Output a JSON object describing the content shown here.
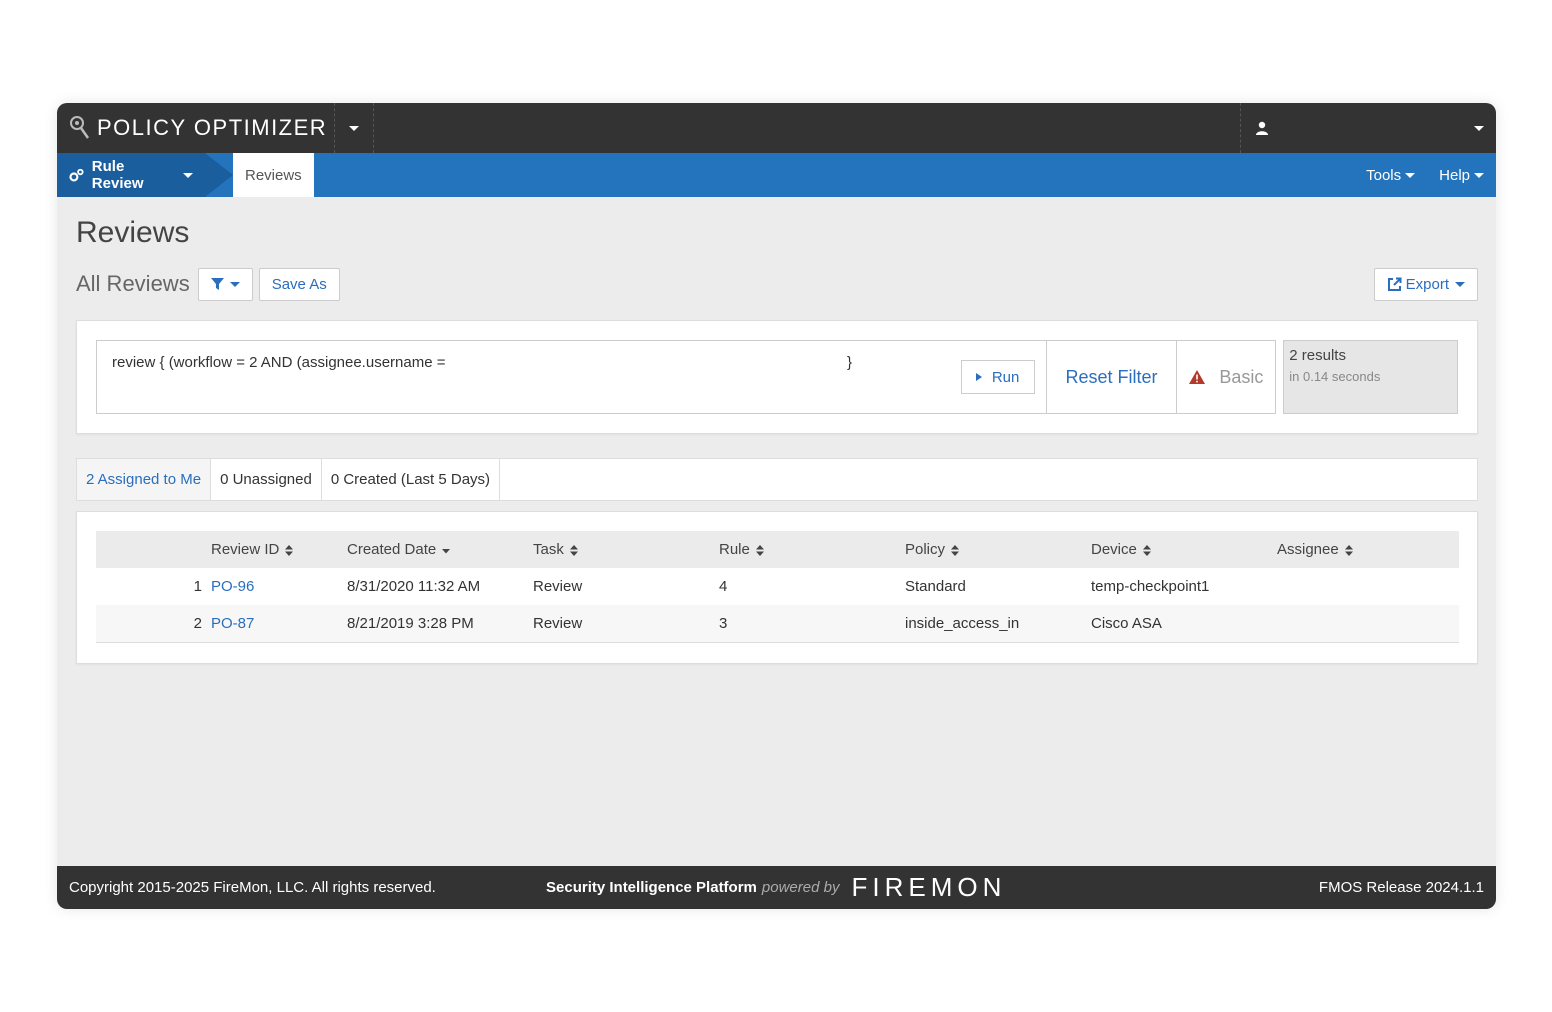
{
  "app": {
    "title": "POLICY OPTIMIZER"
  },
  "nav": {
    "module_label": "Rule Review",
    "breadcrumb": "Reviews",
    "tools_label": "Tools",
    "help_label": "Help"
  },
  "page": {
    "title": "Reviews",
    "subtitle": "All Reviews",
    "save_as_label": "Save As",
    "export_label": "Export"
  },
  "filter": {
    "query_text": "review { (workflow = 2 AND (assignee.username =",
    "query_close": "}",
    "run_label": "Run",
    "reset_label": "Reset Filter",
    "basic_label": "Basic",
    "results_count": "2 results",
    "results_time": "in 0.14 seconds"
  },
  "tabs": [
    {
      "label": "2 Assigned to Me",
      "active": true
    },
    {
      "label": "0 Unassigned",
      "active": false
    },
    {
      "label": "0 Created (Last 5 Days)",
      "active": false
    }
  ],
  "table": {
    "columns": [
      "Review ID",
      "Created Date",
      "Task",
      "Rule",
      "Policy",
      "Device",
      "Assignee"
    ],
    "rows": [
      {
        "index": "1",
        "review_id": "PO-96",
        "created": "8/31/2020 11:32 AM",
        "task": "Review",
        "rule": "4",
        "policy": "Standard",
        "device": "temp-checkpoint1",
        "assignee": ""
      },
      {
        "index": "2",
        "review_id": "PO-87",
        "created": "8/21/2019 3:28 PM",
        "task": "Review",
        "rule": "3",
        "policy": "inside_access_in",
        "device": "Cisco ASA",
        "assignee": ""
      }
    ]
  },
  "footer": {
    "copyright": "Copyright 2015-2025 FireMon, LLC. All rights reserved.",
    "platform": "Security Intelligence Platform",
    "powered_by": "powered by",
    "brand": "FIREMON",
    "release": "FMOS Release 2024.1.1"
  },
  "colors": {
    "topbar": "#333333",
    "navbar": "#2474bd",
    "module": "#1b5e9e",
    "link": "#2a6ebd",
    "background": "#ececec"
  }
}
